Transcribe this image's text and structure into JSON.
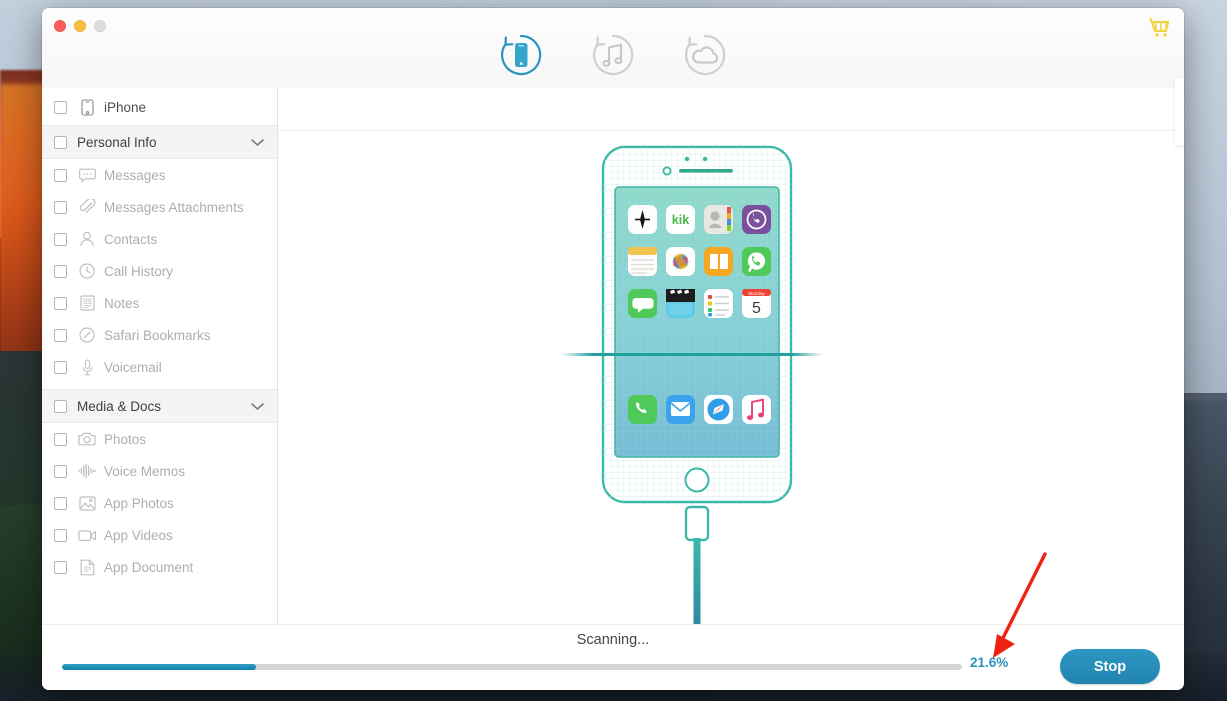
{
  "window": {
    "traffic_lights": [
      "close",
      "minimize",
      "zoom"
    ],
    "cart_icon": "shopping-cart-icon"
  },
  "toolbar": {
    "modes": [
      {
        "id": "ios-device",
        "icon": "recover-from-ios-device-icon",
        "active": true
      },
      {
        "id": "itunes",
        "icon": "recover-from-itunes-backup-icon",
        "active": false
      },
      {
        "id": "icloud",
        "icon": "recover-from-icloud-backup-icon",
        "active": false
      }
    ]
  },
  "sidebar": {
    "device": {
      "label": "iPhone",
      "icon": "iphone-icon",
      "checked": false
    },
    "groups": [
      {
        "label": "Personal Info",
        "expanded": true,
        "checked": false,
        "items": [
          {
            "label": "Messages",
            "icon": "messages-icon",
            "checked": false
          },
          {
            "label": "Messages Attachments",
            "icon": "attachment-icon",
            "checked": false
          },
          {
            "label": "Contacts",
            "icon": "contacts-icon",
            "checked": false
          },
          {
            "label": "Call History",
            "icon": "clock-icon",
            "checked": false
          },
          {
            "label": "Notes",
            "icon": "notes-icon",
            "checked": false
          },
          {
            "label": "Safari Bookmarks",
            "icon": "safari-bookmarks-icon",
            "checked": false
          },
          {
            "label": "Voicemail",
            "icon": "microphone-icon",
            "checked": false
          }
        ]
      },
      {
        "label": "Media & Docs",
        "expanded": true,
        "checked": false,
        "items": [
          {
            "label": "Photos",
            "icon": "camera-icon",
            "checked": false
          },
          {
            "label": "Voice Memos",
            "icon": "waveform-icon",
            "checked": false
          },
          {
            "label": "App Photos",
            "icon": "image-icon",
            "checked": false
          },
          {
            "label": "App Videos",
            "icon": "video-camera-icon",
            "checked": false
          },
          {
            "label": "App Document",
            "icon": "document-icon",
            "checked": false
          }
        ]
      }
    ]
  },
  "stage": {
    "phone_illustration": "iphone-scanning-illustration",
    "home_screen_apps": [
      "voice-memos-app-icon",
      "kik-app-icon",
      "contacts-app-icon",
      "viber-app-icon",
      "notes-app-icon",
      "photos-app-icon",
      "ibooks-app-icon",
      "whatsapp-app-icon",
      "messages-app-icon",
      "videos-app-icon",
      "reminders-app-icon",
      "calendar-app-icon"
    ],
    "calendar_day": "5",
    "calendar_month": "Monday",
    "kik_label": "kik",
    "dock_apps": [
      "phone-app-icon",
      "mail-app-icon",
      "safari-app-icon",
      "music-app-icon"
    ],
    "scan_line": true,
    "cable": "lightning-cable"
  },
  "footer": {
    "status_text": "Scanning...",
    "progress_percent": "21.6%",
    "progress_value": 21.6,
    "stop_label": "Stop"
  },
  "annotation": {
    "arrow": "red-arrow-pointing-to-progress-percent",
    "color": "#ee2211"
  },
  "colors": {
    "accent_teal": "#2a93bf",
    "phone_teal": "#3cb8a8",
    "sidebar_label": "#aeaeae",
    "stop_button": "#2489b4",
    "cart_yellow": "#f2d64b"
  }
}
